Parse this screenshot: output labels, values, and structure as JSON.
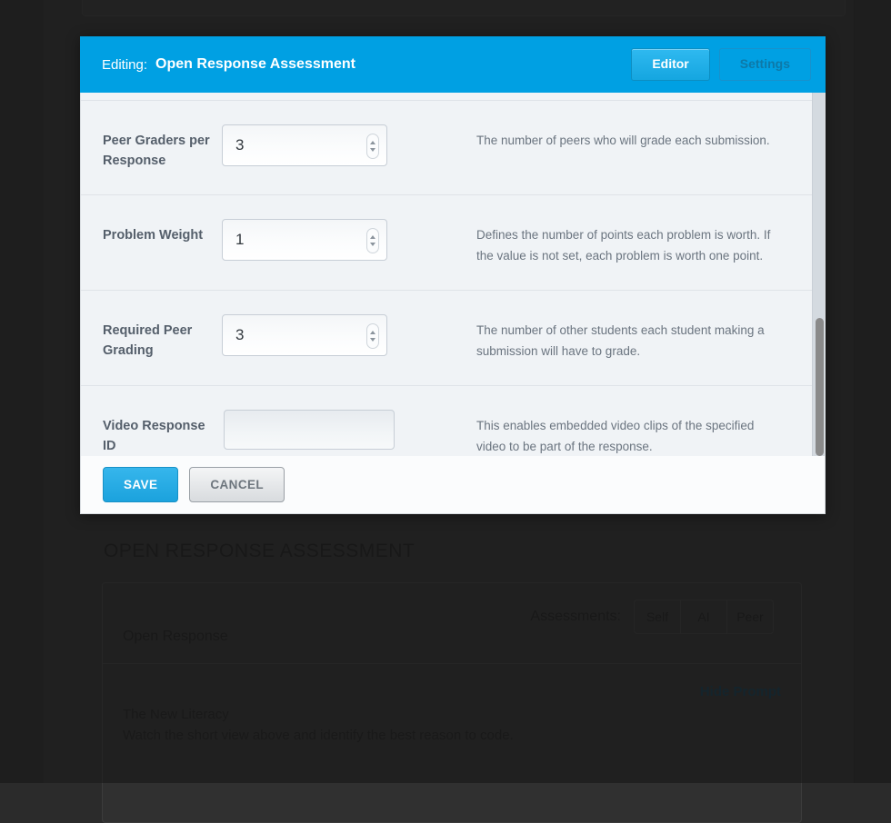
{
  "modal": {
    "header": {
      "editing_label": "Editing:",
      "title": "Open Response Assessment",
      "tabs": [
        {
          "label": "Editor",
          "state": "active"
        },
        {
          "label": "Settings",
          "state": "inactive"
        }
      ]
    },
    "fields": [
      {
        "label": "Peer Graders per Response",
        "type": "number",
        "value": "3",
        "help": "The number of peers who will grade each submission."
      },
      {
        "label": "Problem Weight",
        "type": "number",
        "value": "1",
        "help": "Defines the number of points each problem is worth. If the value is not set, each problem is worth one point."
      },
      {
        "label": "Required Peer Grading",
        "type": "number",
        "value": "3",
        "help": "The number of other students each student making a submission will have to grade."
      },
      {
        "label": "Video Response ID",
        "type": "text",
        "value": "",
        "help": "This enables embedded video clips of the specified video to be part of the response."
      }
    ],
    "footer": {
      "save_label": "SAVE",
      "cancel_label": "CANCEL"
    }
  },
  "page": {
    "section_heading": "OPEN RESPONSE ASSESSMENT",
    "card": {
      "title": "Open Response",
      "assessments_label": "Assessments:",
      "assessment_options": [
        "Self",
        "AI",
        "Peer"
      ],
      "hide_prompt_label": "Hide Prompt",
      "prompt_title": "The New Literacy",
      "prompt_text": "Watch the short view above and identify the best reason to code."
    }
  },
  "colors": {
    "accent_blue": "#00a0e3",
    "save_blue": "#1ba2dd",
    "link_teal": "#15394b"
  }
}
